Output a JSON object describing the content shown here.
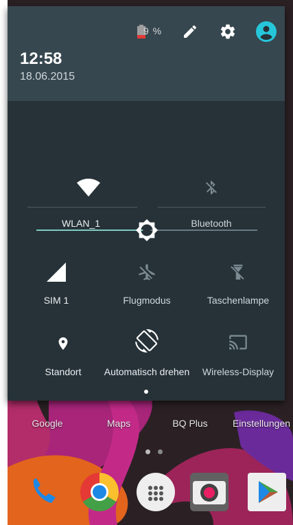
{
  "status_header": {
    "battery_percent": "9 %",
    "time": "12:58",
    "date": "18.06.2015",
    "icons": [
      "battery-low-icon",
      "edit-pencil-icon",
      "settings-gear-icon",
      "user-account-icon"
    ]
  },
  "brightness": {
    "level": 0.5
  },
  "tiles": [
    {
      "label": "WLAN_1",
      "icon": "wifi-icon",
      "state": "on"
    },
    {
      "label": "Bluetooth",
      "icon": "bluetooth-disabled-icon",
      "state": "off"
    },
    {
      "label": "SIM 1",
      "icon": "cellular-signal-icon",
      "state": "on"
    },
    {
      "label": "Flugmodus",
      "icon": "airplane-mode-icon",
      "state": "off"
    },
    {
      "label": "Taschenlampe",
      "icon": "flashlight-off-icon",
      "state": "off"
    },
    {
      "label": "Standort",
      "icon": "location-pin-icon",
      "state": "on"
    },
    {
      "label": "Automatisch drehen",
      "icon": "auto-rotate-icon",
      "state": "on"
    },
    {
      "label": "Wireless-Display",
      "icon": "cast-icon",
      "state": "off"
    }
  ],
  "home_screen": {
    "apps": [
      "Google",
      "Maps",
      "BQ Plus",
      "Einstellungen"
    ],
    "dock": [
      "phone-icon",
      "chrome-icon",
      "app-drawer-icon",
      "camera-icon",
      "play-store-icon"
    ]
  },
  "colors": {
    "header_bg": "#37474f",
    "panel_bg": "#263238",
    "accent": "#80cbc4",
    "account_icon": "#26c6da"
  }
}
